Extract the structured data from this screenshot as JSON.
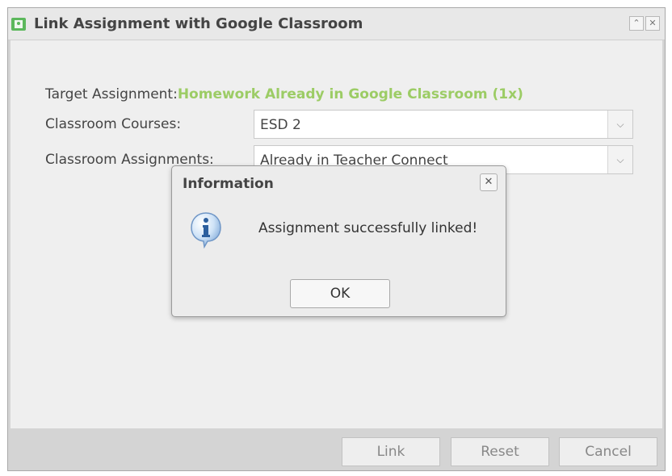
{
  "window": {
    "title": "Link Assignment with Google Classroom",
    "restore_icon": "chevron-up-double-icon",
    "close_icon": "close-icon"
  },
  "form": {
    "target_label": "Target Assignment:",
    "target_value": "Homework Already in Google Classroom (1x)",
    "courses_label": "Classroom Courses:",
    "courses_value": "ESD 2",
    "assignments_label": "Classroom Assignments:",
    "assignments_value": "Already in Teacher Connect"
  },
  "footer": {
    "link_label": "Link",
    "reset_label": "Reset",
    "cancel_label": "Cancel"
  },
  "dialog": {
    "title": "Information",
    "message": "Assignment successfully linked!",
    "ok_label": "OK",
    "icon": "info-icon"
  },
  "colors": {
    "accent_green": "#9ccc65",
    "window_bg": "#d4d4d4",
    "content_bg": "#efefef"
  }
}
